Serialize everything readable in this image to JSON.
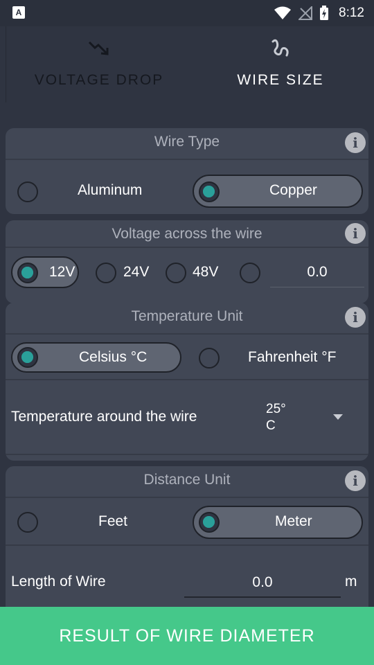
{
  "status_bar": {
    "time": "8:12",
    "app_icon_letter": "A"
  },
  "tabs": [
    {
      "label": "VOLTAGE DROP",
      "icon": "trend-down-icon"
    },
    {
      "label": "WIRE SIZE",
      "icon": "wire-coil-icon"
    }
  ],
  "wire_type": {
    "title": "Wire Type",
    "options": [
      "Aluminum",
      "Copper"
    ],
    "selected": "Copper"
  },
  "voltage": {
    "title": "Voltage across the wire",
    "options": [
      "12V",
      "24V",
      "48V"
    ],
    "selected": "12V",
    "custom_value": "0.0"
  },
  "temperature_unit": {
    "title": "Temperature Unit",
    "options": [
      "Celsius °C",
      "Fahrenheit °F"
    ],
    "selected": "Celsius °C",
    "around_label": "Temperature around the wire",
    "around_value_line1": "25°",
    "around_value_line2": "C"
  },
  "distance_unit": {
    "title": "Distance Unit",
    "options": [
      "Feet",
      "Meter"
    ],
    "selected": "Meter",
    "length_label": "Length of Wire",
    "length_value": "0.0",
    "length_unit": "m"
  },
  "result_button": {
    "label": "RESULT OF WIRE DIAMETER"
  },
  "colors": {
    "accent": "#2aa09a",
    "result_button": "#45c88a",
    "card": "#414755",
    "background": "#2f3441"
  }
}
